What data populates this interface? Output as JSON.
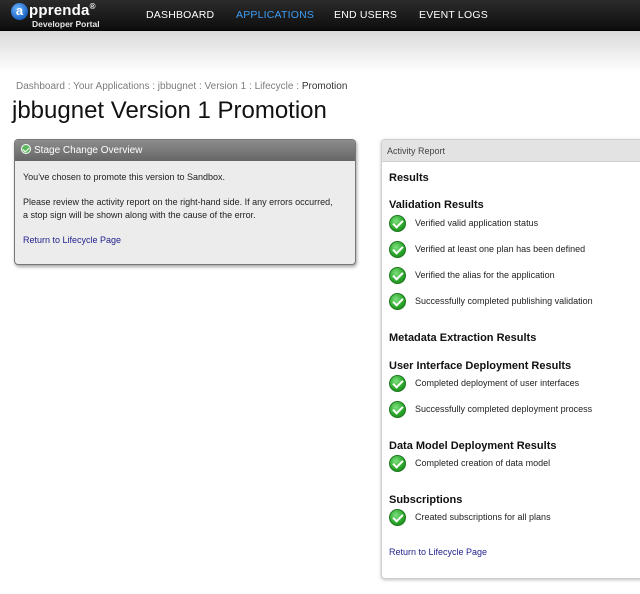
{
  "logo": {
    "mark": "a",
    "name": "pprenda",
    "reg": "®",
    "subtitle": "Developer Portal"
  },
  "nav": [
    "DASHBOARD",
    "APPLICATIONS",
    "END USERS",
    "EVENT LOGS"
  ],
  "breadcrumb": {
    "items": [
      "Dashboard",
      "Your Applications",
      "jbbugnet",
      "Version 1",
      "Lifecycle"
    ],
    "separator": ":",
    "current": "Promotion"
  },
  "page_title": "jbbugnet Version 1 Promotion",
  "overview": {
    "header": "Stage Change Overview",
    "line1": "You've chosen to promote this version to Sandbox.",
    "line2": "Please review the activity report on the right-hand side. If any errors occurred,",
    "line3": "a stop sign will be shown along with the cause of the error.",
    "link": "Return to Lifecycle Page"
  },
  "activity": {
    "header": "Activity Report",
    "results_title": "Results",
    "sections": [
      {
        "title": "Validation Results",
        "items": [
          "Verified valid application status",
          "Verified at least one plan has been defined",
          "Verified the alias for the application",
          "Successfully completed publishing validation"
        ]
      },
      {
        "title": "Metadata Extraction Results",
        "items": []
      },
      {
        "title": "User Interface Deployment Results",
        "items": [
          "Completed deployment of user interfaces",
          "Successfully completed deployment process"
        ]
      },
      {
        "title": "Data Model Deployment Results",
        "items": [
          "Completed creation of data model"
        ]
      },
      {
        "title": "Subscriptions",
        "items": [
          "Created subscriptions for all plans"
        ]
      }
    ],
    "link": "Return to Lifecycle Page"
  },
  "colors": {
    "nav_active": "#3d9df5",
    "link": "#23238e",
    "success": "#27a327"
  },
  "icons": {
    "status": "check-circle-icon"
  }
}
